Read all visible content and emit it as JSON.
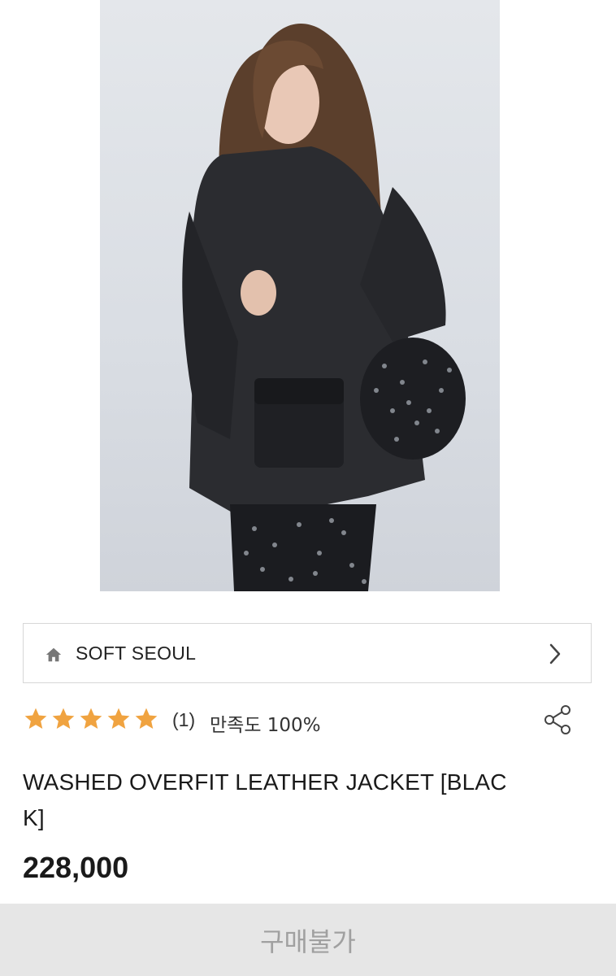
{
  "brand": {
    "name": "SOFT SEOUL",
    "icon": "home-icon",
    "chevron_icon": "chevron-right-icon"
  },
  "rating": {
    "stars": 5,
    "review_count": "(1)",
    "satisfaction": "만족도 100%",
    "star_color": "#f0a340",
    "share_icon": "share-icon"
  },
  "product": {
    "title": "WASHED OVERFIT LEATHER JACKET [BLACK]",
    "price": "228,000"
  },
  "buy_button": {
    "label": "구매불가"
  }
}
